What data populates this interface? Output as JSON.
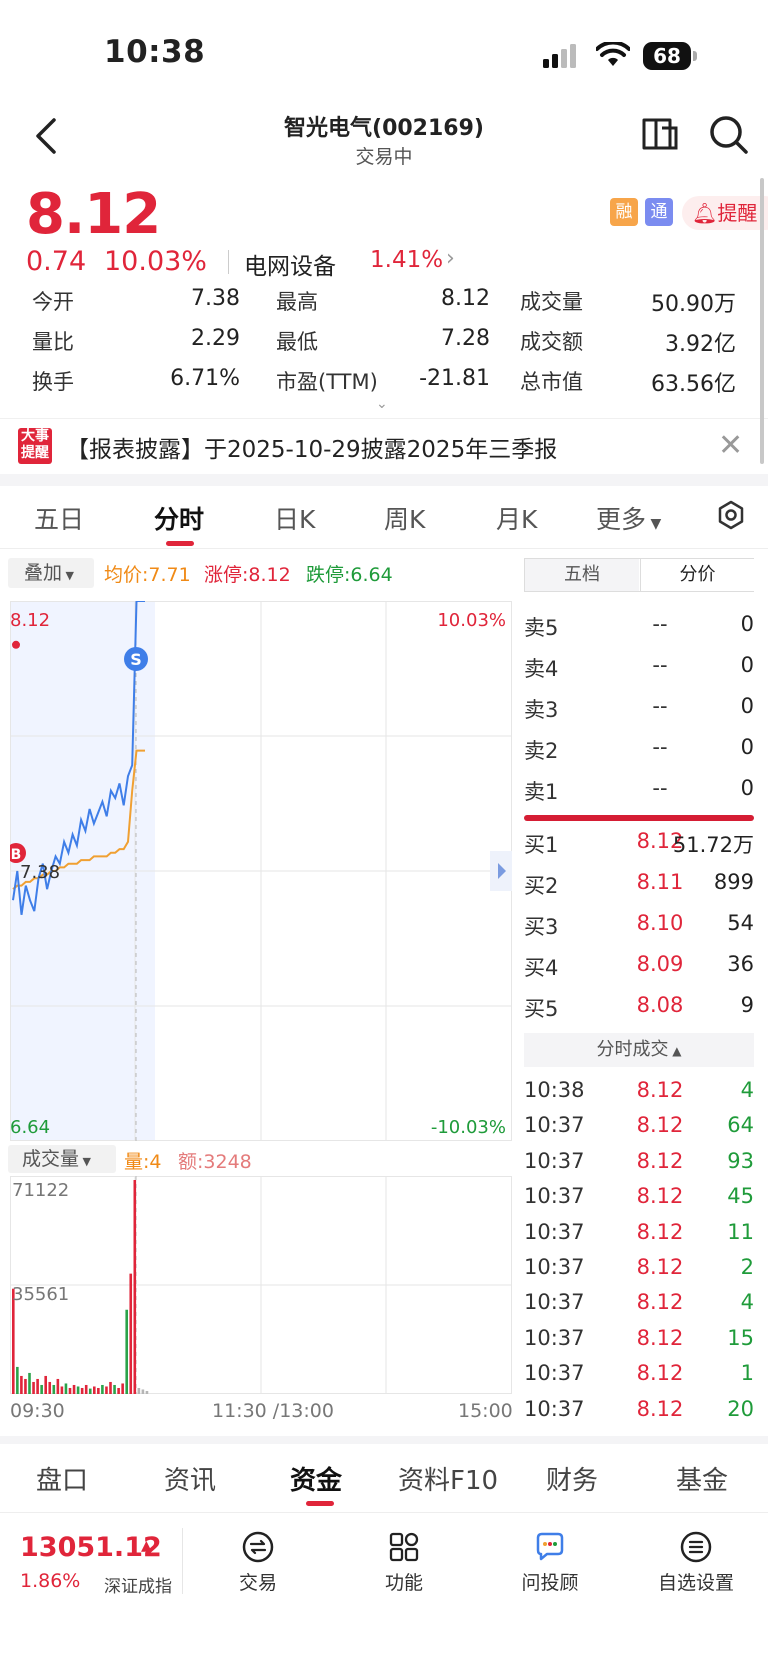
{
  "status_bar": {
    "time": "10:38",
    "battery": "68"
  },
  "header": {
    "title": "智光电气(002169)",
    "status": "交易中"
  },
  "quote": {
    "price": "8.12",
    "change": "0.74",
    "change_pct": "10.03%",
    "sector_name": "电网设备",
    "sector_pct": "1.41%",
    "tags": [
      "融",
      "通"
    ],
    "alert_label": "提醒"
  },
  "stats": [
    {
      "label": "今开",
      "value": "7.38",
      "color": "#222222"
    },
    {
      "label": "最高",
      "value": "8.12",
      "color": "#e0253a"
    },
    {
      "label": "成交量",
      "value": "50.90万",
      "color": "#222222"
    },
    {
      "label": "量比",
      "value": "2.29",
      "color": "#222222"
    },
    {
      "label": "最低",
      "value": "7.28",
      "color": "#1f9b3a"
    },
    {
      "label": "成交额",
      "value": "3.92亿",
      "color": "#222222"
    },
    {
      "label": "换手",
      "value": "6.71%",
      "color": "#222222"
    },
    {
      "label": "市盈(TTM)",
      "value": "-21.81",
      "color": "#222222"
    },
    {
      "label": "总市值",
      "value": "63.56亿",
      "color": "#222222"
    }
  ],
  "notice": {
    "badge_top": "大事",
    "badge_bottom": "提醒",
    "text": "【报表披露】于2025-10-29披露2025年三季报"
  },
  "period_tabs": [
    "五日",
    "分时",
    "日K",
    "周K",
    "月K",
    "更多"
  ],
  "chart_header": {
    "overlay": "叠加",
    "avg_price": "均价:7.71",
    "limit_up": "涨停:8.12",
    "limit_down": "跌停:6.64"
  },
  "chart_labels": {
    "top_price": "8.12",
    "top_pct": "10.03%",
    "bottom_price": "6.64",
    "bottom_pct": "-10.03%",
    "open_price": "7.38",
    "marker_s": "S",
    "marker_b": "B"
  },
  "volume_header": {
    "label": "成交量",
    "amount": "量:4",
    "money": "额:3248"
  },
  "volume_labels": {
    "max": "71122",
    "mid": "35561"
  },
  "time_axis": {
    "start": "09:30",
    "mid": "11:30 /13:00",
    "end": "15:00"
  },
  "order_book": {
    "tabs": [
      "五档",
      "分价"
    ],
    "asks": [
      {
        "label": "卖5",
        "price": "--",
        "vol": "0"
      },
      {
        "label": "卖4",
        "price": "--",
        "vol": "0"
      },
      {
        "label": "卖3",
        "price": "--",
        "vol": "0"
      },
      {
        "label": "卖2",
        "price": "--",
        "vol": "0"
      },
      {
        "label": "卖1",
        "price": "--",
        "vol": "0"
      }
    ],
    "bids": [
      {
        "label": "买1",
        "price": "8.12",
        "vol": "51.72万"
      },
      {
        "label": "买2",
        "price": "8.11",
        "vol": "899"
      },
      {
        "label": "买3",
        "price": "8.10",
        "vol": "54"
      },
      {
        "label": "买4",
        "price": "8.09",
        "vol": "36"
      },
      {
        "label": "买5",
        "price": "8.08",
        "vol": "9"
      }
    ]
  },
  "ticks": {
    "header": "分时成交",
    "rows": [
      {
        "time": "10:38",
        "price": "8.12",
        "vol": "4",
        "color": "#1f9b3a"
      },
      {
        "time": "10:37",
        "price": "8.12",
        "vol": "64",
        "color": "#1f9b3a"
      },
      {
        "time": "10:37",
        "price": "8.12",
        "vol": "93",
        "color": "#1f9b3a"
      },
      {
        "time": "10:37",
        "price": "8.12",
        "vol": "45",
        "color": "#1f9b3a"
      },
      {
        "time": "10:37",
        "price": "8.12",
        "vol": "11",
        "color": "#1f9b3a"
      },
      {
        "time": "10:37",
        "price": "8.12",
        "vol": "2",
        "color": "#1f9b3a"
      },
      {
        "time": "10:37",
        "price": "8.12",
        "vol": "4",
        "color": "#1f9b3a"
      },
      {
        "time": "10:37",
        "price": "8.12",
        "vol": "15",
        "color": "#1f9b3a"
      },
      {
        "time": "10:37",
        "price": "8.12",
        "vol": "1",
        "color": "#1f9b3a"
      },
      {
        "time": "10:37",
        "price": "8.12",
        "vol": "20",
        "color": "#1f9b3a"
      }
    ]
  },
  "bottom_tabs": [
    "盘口",
    "资讯",
    "资金",
    "资料F10",
    "财务",
    "基金"
  ],
  "footer": {
    "index_value": "13051.12",
    "index_pct": "1.86%",
    "index_name": "深证成指",
    "buttons": [
      {
        "label": "交易",
        "icon": "exchange-icon"
      },
      {
        "label": "功能",
        "icon": "grid-icon"
      },
      {
        "label": "问投顾",
        "icon": "chat-icon"
      },
      {
        "label": "自选设置",
        "icon": "list-icon"
      }
    ]
  },
  "chart_data": {
    "type": "line",
    "y_range": [
      6.64,
      8.12
    ],
    "pct_range": [
      "-10.03%",
      "10.03%"
    ],
    "prev_close": 7.38,
    "series": [
      {
        "values": [
          7.3,
          7.38,
          7.26,
          7.34,
          7.3,
          7.27,
          7.36,
          7.4,
          7.33,
          7.38,
          7.42,
          7.4,
          7.46,
          7.43,
          7.48,
          7.45,
          7.52,
          7.49,
          7.55,
          7.51,
          7.54,
          7.57,
          7.53,
          7.6,
          7.58,
          7.62,
          7.56,
          7.64,
          7.67,
          8.12,
          8.12,
          8.12
        ]
      },
      {
        "values": [
          7.33,
          7.34,
          7.34,
          7.35,
          7.35,
          7.36,
          7.36,
          7.37,
          7.37,
          7.38,
          7.38,
          7.39,
          7.39,
          7.4,
          7.4,
          7.4,
          7.41,
          7.41,
          7.41,
          7.42,
          7.42,
          7.42,
          7.42,
          7.43,
          7.43,
          7.44,
          7.44,
          7.46,
          7.6,
          7.71,
          7.71,
          7.71
        ]
      }
    ],
    "volume": [
      35000,
      9000,
      6000,
      5000,
      7000,
      4000,
      5000,
      3000,
      6000,
      4000,
      3000,
      5000,
      2500,
      3500,
      2000,
      3000,
      2500,
      2000,
      3000,
      1800,
      2500,
      2000,
      3000,
      2500,
      4000,
      3000,
      2000,
      3500,
      28000,
      40000,
      71122,
      2000,
      1500,
      1000
    ]
  }
}
